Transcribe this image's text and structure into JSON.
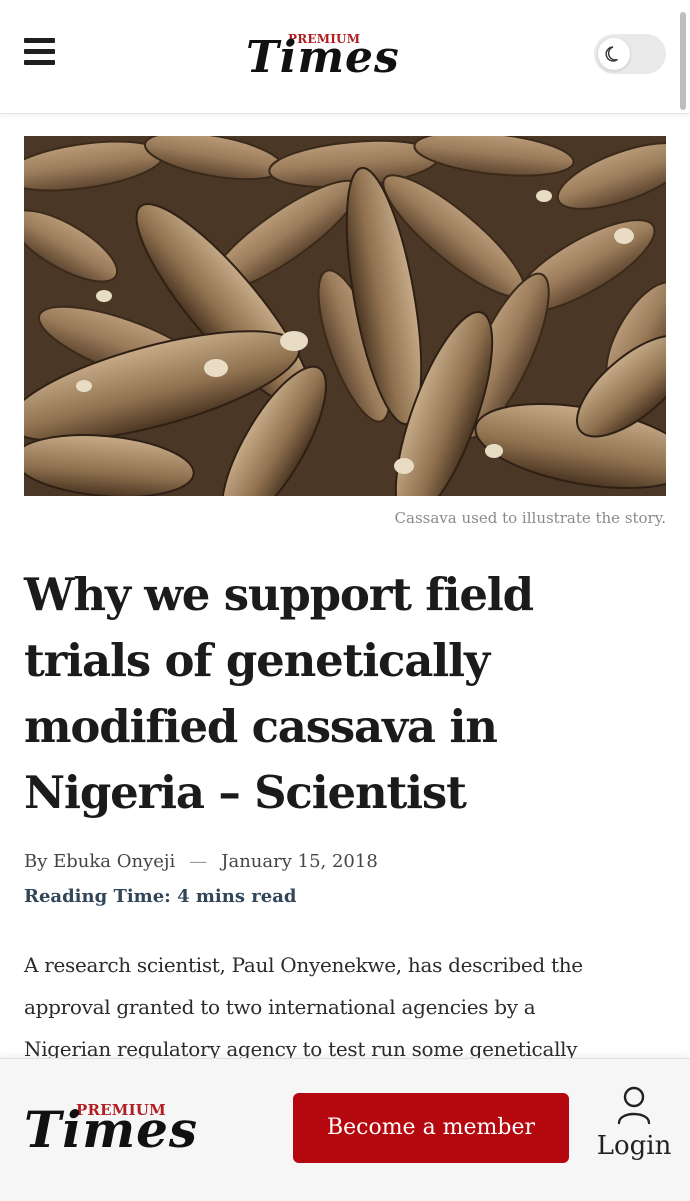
{
  "header": {
    "brand_premium": "PREMIUM",
    "brand_name": "Times",
    "menu_icon": "hamburger-menu-icon",
    "theme_toggle_icon": "moon-icon",
    "theme_toggle_state": "off"
  },
  "hero": {
    "image_icon": "cassava-photo",
    "caption": "Cassava used to illustrate the story."
  },
  "article": {
    "headline_lines": [
      "Why we support field",
      "trials of genetically",
      "modified cassava in",
      "Nigeria – Scientist"
    ],
    "byline_prefix": "By",
    "author": "Ebuka Onyeji",
    "separator": "—",
    "date": "January 15, 2018",
    "reading_time_label": "Reading Time:",
    "reading_time_value": "4 mins read",
    "body_lines": [
      "A research scientist, Paul Onyenekwe, has described the",
      "approval granted to two international agencies by a",
      "Nigerian regulatory agency to test run some genetically"
    ]
  },
  "footer": {
    "brand_premium": "PREMIUM",
    "brand_name": "Times",
    "member_button": "Become a member",
    "login_label": "Login",
    "login_icon": "user-icon"
  },
  "colors": {
    "brand_red": "#b01e23",
    "button_red": "#b4070e",
    "reading_time": "#32465a"
  }
}
